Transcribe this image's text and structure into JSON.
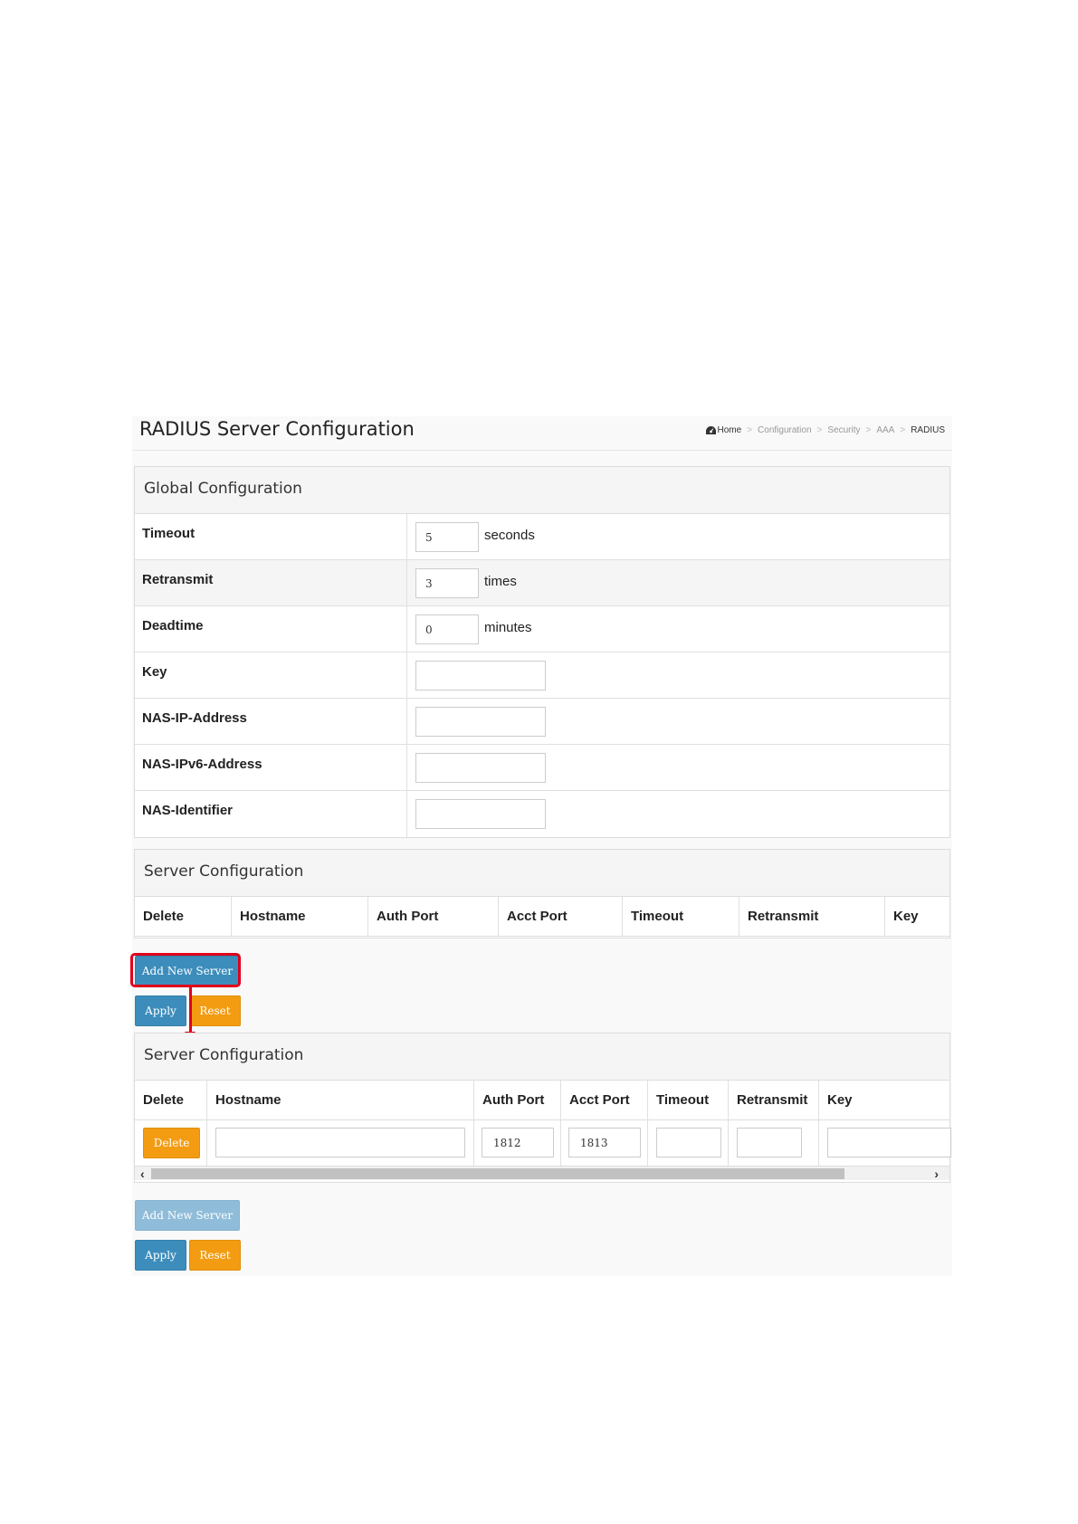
{
  "header": {
    "title": "RADIUS Server Configuration",
    "breadcrumb": [
      "Home",
      "Configuration",
      "Security",
      "AAA",
      "RADIUS"
    ]
  },
  "global": {
    "title": "Global Configuration",
    "rows": [
      {
        "label": "Timeout",
        "value": "5",
        "unit": "seconds"
      },
      {
        "label": "Retransmit",
        "value": "3",
        "unit": "times"
      },
      {
        "label": "Deadtime",
        "value": "0",
        "unit": "minutes"
      },
      {
        "label": "Key",
        "value": ""
      },
      {
        "label": "NAS-IP-Address",
        "value": ""
      },
      {
        "label": "NAS-IPv6-Address",
        "value": ""
      },
      {
        "label": "NAS-Identifier",
        "value": ""
      }
    ]
  },
  "server_before": {
    "title": "Server Configuration",
    "columns": [
      "Delete",
      "Hostname",
      "Auth Port",
      "Acct Port",
      "Timeout",
      "Retransmit",
      "Key"
    ],
    "add_label": "Add New Server",
    "apply_label": "Apply",
    "reset_label": "Reset"
  },
  "server_after": {
    "title": "Server Configuration",
    "columns": [
      "Delete",
      "Hostname",
      "Auth Port",
      "Acct Port",
      "Timeout",
      "Retransmit",
      "Key"
    ],
    "row": {
      "delete_label": "Delete",
      "hostname": "",
      "auth_port": "1812",
      "acct_port": "1813",
      "timeout": "",
      "retransmit": "",
      "key": ""
    },
    "add_label": "Add New Server",
    "apply_label": "Apply",
    "reset_label": "Reset"
  },
  "colors": {
    "primary": "#3c8dbc",
    "warning": "#f39c12",
    "annotation": "#e0001b"
  }
}
